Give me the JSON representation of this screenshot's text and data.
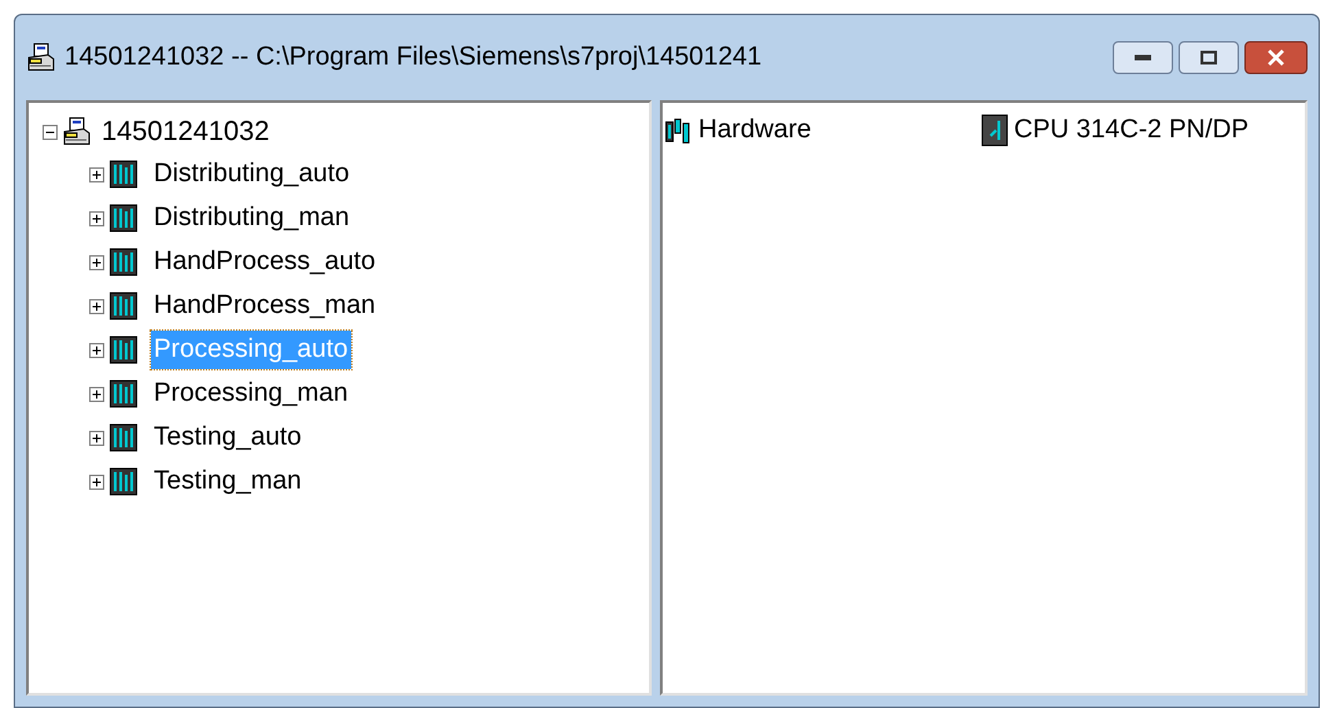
{
  "window": {
    "title": "14501241032 -- C:\\Program Files\\Siemens\\s7proj\\14501241"
  },
  "tree": {
    "label": "14501241032",
    "expanded": true,
    "children": [
      {
        "label": "Distributing_auto",
        "expanded": false,
        "selected": false
      },
      {
        "label": "Distributing_man",
        "expanded": false,
        "selected": false
      },
      {
        "label": "HandProcess_auto",
        "expanded": false,
        "selected": false
      },
      {
        "label": "HandProcess_man",
        "expanded": false,
        "selected": false
      },
      {
        "label": "Processing_auto",
        "expanded": false,
        "selected": true
      },
      {
        "label": "Processing_man",
        "expanded": false,
        "selected": false
      },
      {
        "label": "Testing_auto",
        "expanded": false,
        "selected": false
      },
      {
        "label": "Testing_man",
        "expanded": false,
        "selected": false
      }
    ]
  },
  "objects": [
    {
      "label": "Hardware",
      "kind": "hardware"
    },
    {
      "label": "CPU 314C-2 PN/DP",
      "kind": "cpu"
    }
  ]
}
